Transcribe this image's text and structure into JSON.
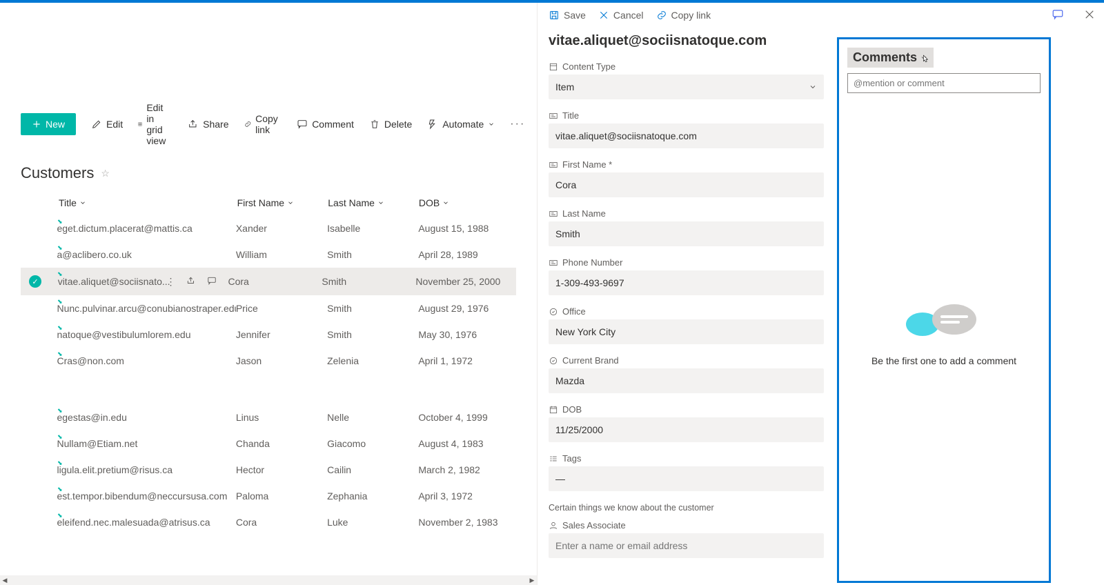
{
  "toolbar": {
    "save": "Save",
    "cancel": "Cancel",
    "copylink": "Copy link"
  },
  "detail": {
    "heading": "vitae.aliquet@sociisnatoque.com",
    "fields": {
      "content_type_label": "Content Type",
      "content_type_value": "Item",
      "title_label": "Title",
      "title_value": "vitae.aliquet@sociisnatoque.com",
      "first_name_label": "First Name *",
      "first_name_value": "Cora",
      "last_name_label": "Last Name",
      "last_name_value": "Smith",
      "phone_label": "Phone Number",
      "phone_value": "1-309-493-9697",
      "office_label": "Office",
      "office_value": "New York City",
      "brand_label": "Current Brand",
      "brand_value": "Mazda",
      "dob_label": "DOB",
      "dob_value": "11/25/2000",
      "tags_label": "Tags",
      "tags_value": "—",
      "tags_helper": "Certain things we know about the customer",
      "sales_label": "Sales Associate",
      "sales_placeholder": "Enter a name or email address"
    }
  },
  "commands": {
    "new": "New",
    "edit": "Edit",
    "edit_grid": "Edit in grid view",
    "share": "Share",
    "copylink": "Copy link",
    "comment": "Comment",
    "delete": "Delete",
    "automate": "Automate"
  },
  "list": {
    "title": "Customers",
    "columns": {
      "title": "Title",
      "first": "First Name",
      "last": "Last Name",
      "dob": "DOB"
    },
    "rows": [
      {
        "title": "eget.dictum.placerat@mattis.ca",
        "first": "Xander",
        "last": "Isabelle",
        "dob": "August 15, 1988"
      },
      {
        "title": "a@aclibero.co.uk",
        "first": "William",
        "last": "Smith",
        "dob": "April 28, 1989"
      },
      {
        "title": "vitae.aliquet@sociisnato...",
        "first": "Cora",
        "last": "Smith",
        "dob": "November 25, 2000"
      },
      {
        "title": "Nunc.pulvinar.arcu@conubianostraper.edu",
        "first": "Price",
        "last": "Smith",
        "dob": "August 29, 1976"
      },
      {
        "title": "natoque@vestibulumlorem.edu",
        "first": "Jennifer",
        "last": "Smith",
        "dob": "May 30, 1976"
      },
      {
        "title": "Cras@non.com",
        "first": "Jason",
        "last": "Zelenia",
        "dob": "April 1, 1972"
      },
      {
        "title": "egestas@in.edu",
        "first": "Linus",
        "last": "Nelle",
        "dob": "October 4, 1999"
      },
      {
        "title": "Nullam@Etiam.net",
        "first": "Chanda",
        "last": "Giacomo",
        "dob": "August 4, 1983"
      },
      {
        "title": "ligula.elit.pretium@risus.ca",
        "first": "Hector",
        "last": "Cailin",
        "dob": "March 2, 1982"
      },
      {
        "title": "est.tempor.bibendum@neccursusa.com",
        "first": "Paloma",
        "last": "Zephania",
        "dob": "April 3, 1972"
      },
      {
        "title": "eleifend.nec.malesuada@atrisus.ca",
        "first": "Cora",
        "last": "Luke",
        "dob": "November 2, 1983"
      }
    ]
  },
  "comments": {
    "title": "Comments",
    "placeholder": "@mention or comment",
    "empty": "Be the first one to add a comment"
  }
}
